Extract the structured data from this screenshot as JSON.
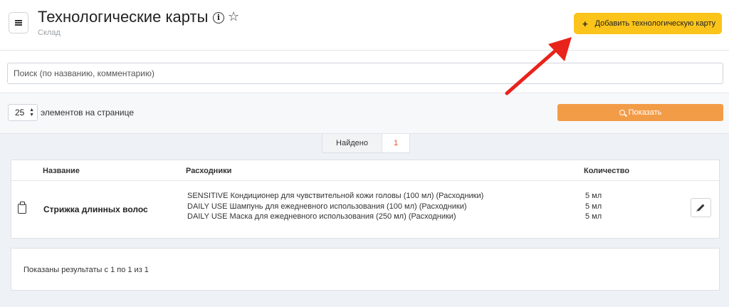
{
  "header": {
    "title": "Технологические карты",
    "subtitle": "Склад",
    "info_icon": "info-icon",
    "star_icon": "star-icon",
    "add_button_label": "Добавить технологическую карту",
    "add_button_plus": "+"
  },
  "search": {
    "placeholder": "Поиск (по названию, комментарию)",
    "value": ""
  },
  "pagination": {
    "per_page": "25",
    "per_page_label": "элементов на странице",
    "show_button_label": "Показать"
  },
  "found": {
    "label": "Найдено",
    "count": "1"
  },
  "table": {
    "columns": [
      "Название",
      "Расходники",
      "Количество"
    ],
    "rows": [
      {
        "name": "Стрижка длинных волос",
        "consumables": [
          "SENSITIVE Кондиционер для чувствительной кожи головы (100 мл) (Расходники)",
          "DAILY USE Шампунь для ежедневного использования (100 мл) (Расходники)",
          "DAILY USE Маска для ежедневного использования (250 мл) (Расходники)"
        ],
        "quantities": [
          "5 мл",
          "5 мл",
          "5 мл"
        ]
      }
    ]
  },
  "footer": {
    "results_text": "Показаны результаты с 1 по 1 из 1"
  },
  "colors": {
    "add_button": "#fbc41a",
    "show_button": "#f39c48",
    "annotation_arrow": "#e8231c",
    "found_count": "#e8501f"
  }
}
